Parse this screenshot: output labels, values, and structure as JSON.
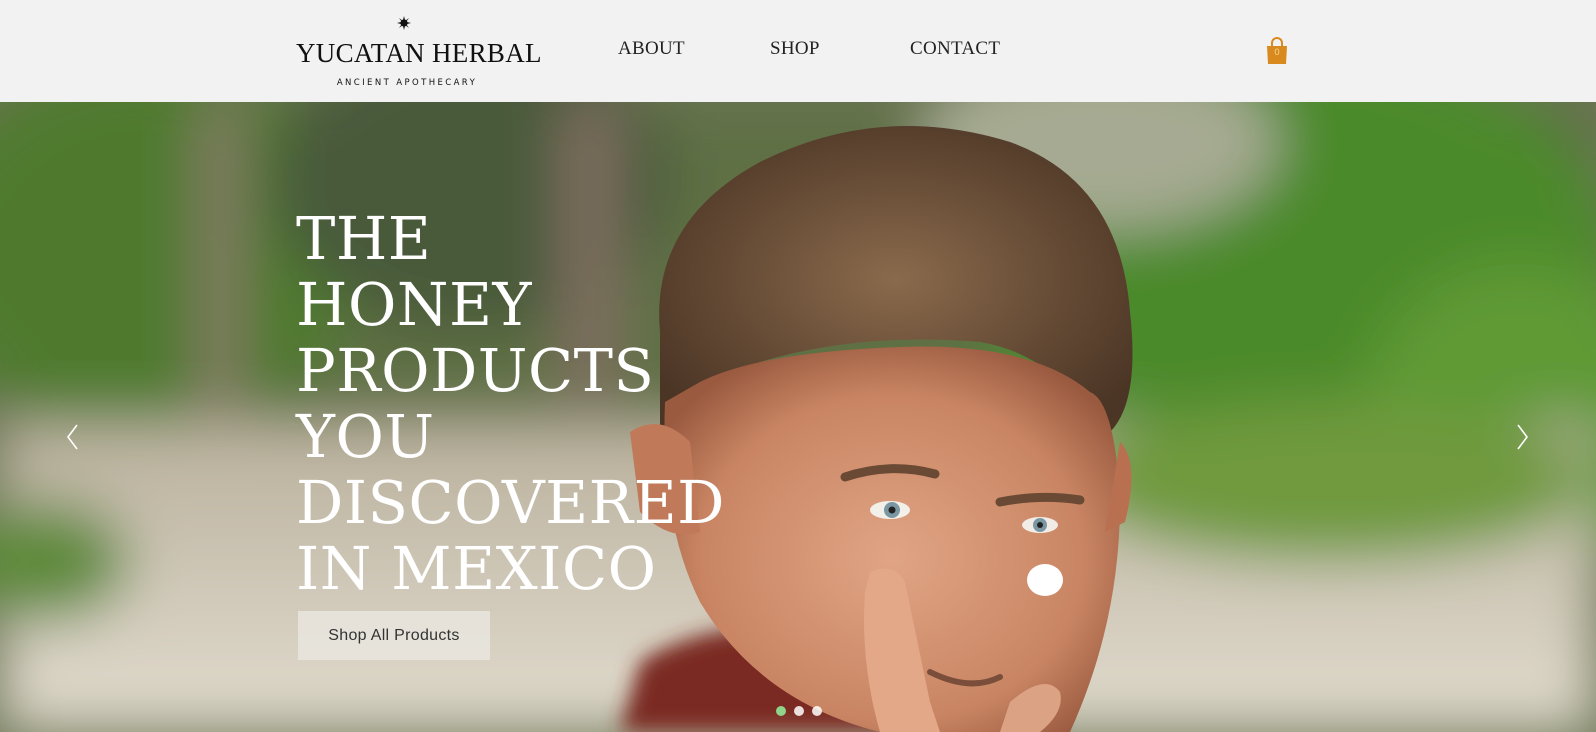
{
  "brand": {
    "name": "YUCATAN HERBAL",
    "tagline": "ANCIENT APOTHECARY"
  },
  "nav": {
    "items": [
      {
        "label": "ABOUT"
      },
      {
        "label": "SHOP"
      },
      {
        "label": "CONTACT"
      }
    ]
  },
  "cart": {
    "count": "0",
    "icon": "shopping-bag-icon",
    "color": "#d98a1e"
  },
  "hero": {
    "headline_lines": [
      "THE",
      "HONEY",
      "PRODUCTS",
      "YOU",
      "DISCOVERED",
      "IN MEXICO"
    ],
    "cta_label": "Shop All Products",
    "slides_total": 3,
    "active_slide": 1,
    "active_dot_color": "#8fd48a"
  },
  "icons": {
    "prev": "chevron-left-icon",
    "next": "chevron-right-icon",
    "logo_mark": "sun-star-icon"
  }
}
